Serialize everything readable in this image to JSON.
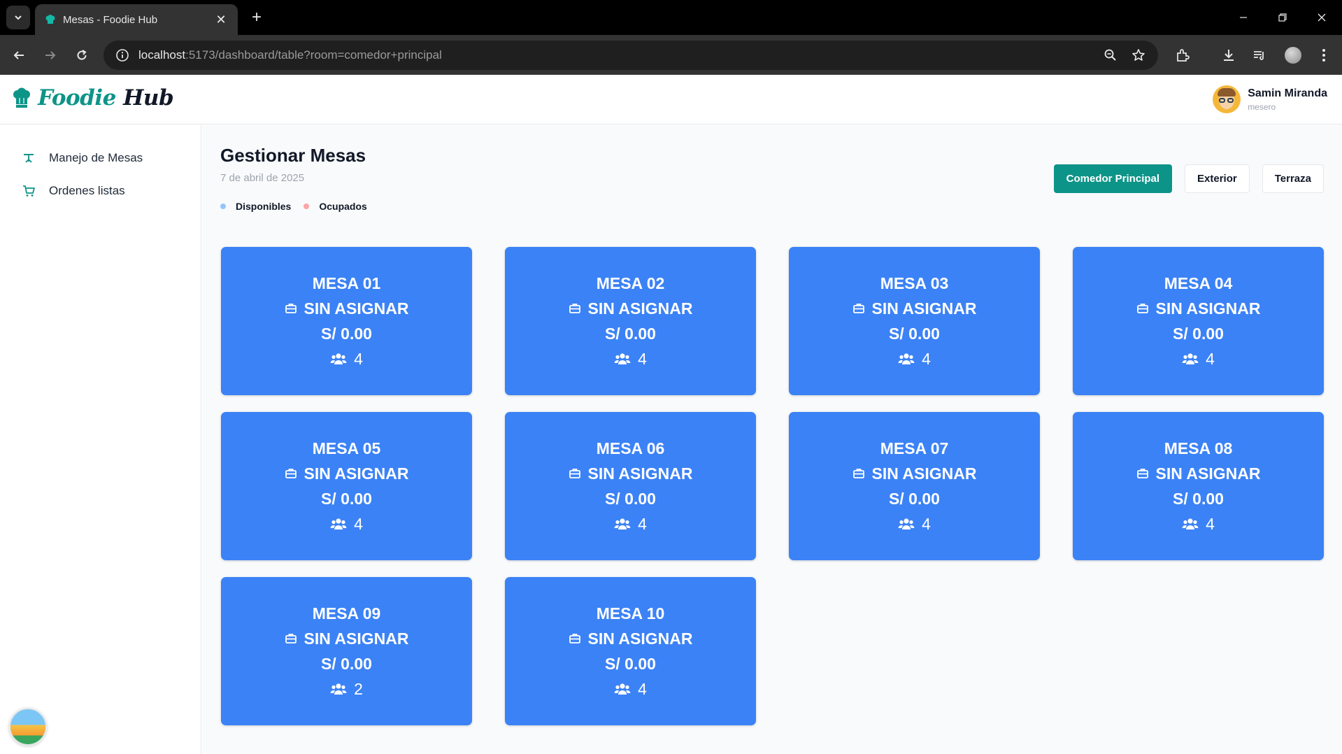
{
  "browser": {
    "tab_title": "Mesas - Foodie Hub",
    "url_host": "localhost",
    "url_rest": ":5173/dashboard/table?room=comedor+principal"
  },
  "app": {
    "logo_word1": "Foodie",
    "logo_word2": "Hub",
    "user_name": "Samin Miranda",
    "user_role": "mesero"
  },
  "sidebar": {
    "items": [
      {
        "label": "Manejo de Mesas",
        "icon": "table-icon"
      },
      {
        "label": "Ordenes listas",
        "icon": "cart-icon"
      }
    ]
  },
  "main": {
    "title": "Gestionar Mesas",
    "date": "7 de abril de 2025",
    "legend": [
      {
        "label": "Disponibles",
        "color": "#93c5fd"
      },
      {
        "label": "Ocupados",
        "color": "#fca5a5"
      }
    ],
    "rooms": [
      {
        "label": "Comedor Principal",
        "active": true
      },
      {
        "label": "Exterior",
        "active": false
      },
      {
        "label": "Terraza",
        "active": false
      }
    ],
    "tables": [
      {
        "name": "MESA 01",
        "status": "SIN ASIGNAR",
        "amount": "S/ 0.00",
        "capacity": "4"
      },
      {
        "name": "MESA 02",
        "status": "SIN ASIGNAR",
        "amount": "S/ 0.00",
        "capacity": "4"
      },
      {
        "name": "MESA 03",
        "status": "SIN ASIGNAR",
        "amount": "S/ 0.00",
        "capacity": "4"
      },
      {
        "name": "MESA 04",
        "status": "SIN ASIGNAR",
        "amount": "S/ 0.00",
        "capacity": "4"
      },
      {
        "name": "MESA 05",
        "status": "SIN ASIGNAR",
        "amount": "S/ 0.00",
        "capacity": "4"
      },
      {
        "name": "MESA 06",
        "status": "SIN ASIGNAR",
        "amount": "S/ 0.00",
        "capacity": "4"
      },
      {
        "name": "MESA 07",
        "status": "SIN ASIGNAR",
        "amount": "S/ 0.00",
        "capacity": "4"
      },
      {
        "name": "MESA 08",
        "status": "SIN ASIGNAR",
        "amount": "S/ 0.00",
        "capacity": "4"
      },
      {
        "name": "MESA 09",
        "status": "SIN ASIGNAR",
        "amount": "S/ 0.00",
        "capacity": "2"
      },
      {
        "name": "MESA 10",
        "status": "SIN ASIGNAR",
        "amount": "S/ 0.00",
        "capacity": "4"
      }
    ]
  },
  "colors": {
    "accent": "#0d9488",
    "card": "#3b82f6"
  }
}
